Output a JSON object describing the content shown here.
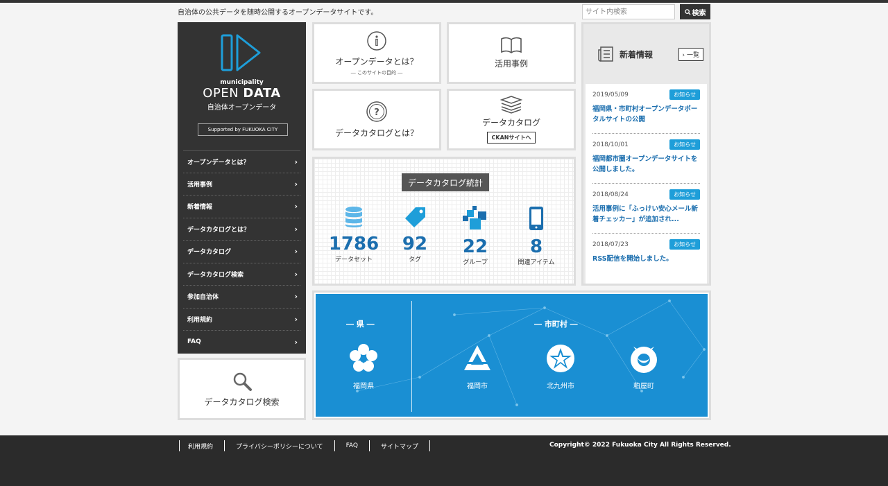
{
  "header": {
    "tagline": "自治体の公共データを随時公開するオープンデータサイトです。",
    "search_placeholder": "サイト内検索",
    "search_button": "検索"
  },
  "logo": {
    "sub": "municipality",
    "main_a": "OPEN ",
    "main_b": "DATA",
    "jp": "自治体オープンデータ",
    "supported": "Supported by FUKUOKA CITY"
  },
  "side_nav": {
    "items": [
      {
        "label": "オープンデータとは？"
      },
      {
        "label": "活用事例"
      },
      {
        "label": "新着情報"
      },
      {
        "label": "データカタログとは？"
      },
      {
        "label": "データカタログ"
      },
      {
        "label": "データカタログ検索"
      },
      {
        "label": "参加自治体"
      },
      {
        "label": "利用規約"
      },
      {
        "label": "FAQ"
      }
    ]
  },
  "search_card": {
    "label": "データカタログ検索"
  },
  "tiles": {
    "about": {
      "label": "オープンデータとは？",
      "sub": "― このサイトの目的 ―"
    },
    "cases": {
      "label": "活用事例"
    },
    "catalog_about": {
      "label": "データカタログとは？"
    },
    "catalog": {
      "label": "データカタログ",
      "ckan": "CKANサイトへ"
    }
  },
  "stats": {
    "title": "データカタログ統計",
    "items": [
      {
        "value": "1786",
        "caption": "データセット"
      },
      {
        "value": "92",
        "caption": "タグ"
      },
      {
        "value": "22",
        "caption": "グループ"
      },
      {
        "value": "8",
        "caption": "関連アイテム"
      }
    ]
  },
  "news": {
    "title": "新着情報",
    "list_button": "一覧",
    "items": [
      {
        "date": "2019/05/09",
        "badge": "お知らせ",
        "text": "福岡県・市町村オープンデータポータルサイトの公開"
      },
      {
        "date": "2018/10/01",
        "badge": "お知らせ",
        "text": "福岡都市圏オープンデータサイトを公開しました。"
      },
      {
        "date": "2018/08/24",
        "badge": "お知らせ",
        "text": "活用事例に「ふっけい安心メール新着チェッカー」が追加され..."
      },
      {
        "date": "2018/07/23",
        "badge": "お知らせ",
        "text": "RSS配信を開始しました。"
      }
    ]
  },
  "map": {
    "pref_heading": "― 県 ―",
    "muni_heading": "― 市町村 ―",
    "pref": {
      "name": "福岡県"
    },
    "munis": [
      {
        "name": "福岡市"
      },
      {
        "name": "北九州市"
      },
      {
        "name": "粕屋町"
      }
    ]
  },
  "footer": {
    "links": [
      {
        "label": "利用規約"
      },
      {
        "label": "プライバシーポリシーについて"
      },
      {
        "label": "FAQ"
      },
      {
        "label": "サイトマップ"
      }
    ],
    "copyright": "Copyright© 2022 Fukuoka City All Rights Reserved."
  },
  "colors": {
    "accent_blue": "#1a8fd3",
    "dark": "#333333",
    "badge": "#1e9ed9"
  }
}
